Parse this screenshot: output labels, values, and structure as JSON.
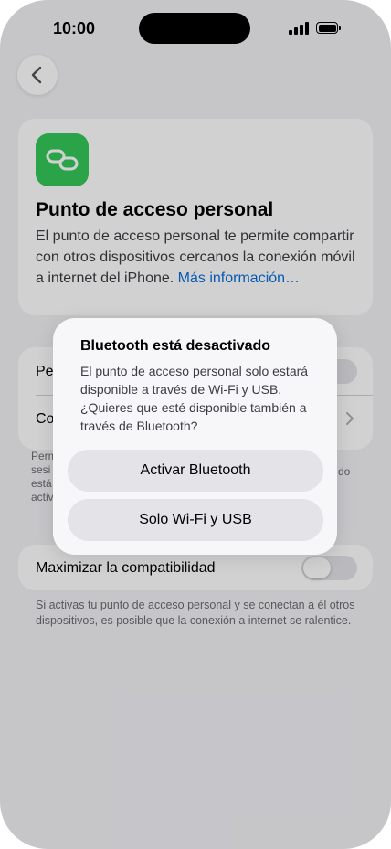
{
  "status": {
    "time": "10:00"
  },
  "hero": {
    "title": "Punto de acceso personal",
    "description": "El punto de acceso personal te permite compartir con otros dispositivos cercanos la conexión móvil a internet del iPhone. ",
    "link": "Más información…"
  },
  "settings": {
    "row1_partial": "Pe",
    "row2_partial": "Co",
    "footer_partial_lines": [
      "Perm",
      "sesi",
      "está",
      "activ"
    ],
    "footer_partial_right": "do"
  },
  "compat": {
    "label": "Maximizar la compatibilidad",
    "footer": "Si activas tu punto de acceso personal y se conectan a él otros dispositivos, es posible que la conexión a internet se ralentice."
  },
  "alert": {
    "title": "Bluetooth está desactivado",
    "message": "El punto de acceso personal solo estará disponible a través de Wi-Fi y USB. ¿Quieres que esté disponible también a través de Bluetooth?",
    "button1": "Activar Bluetooth",
    "button2": "Solo Wi-Fi y USB"
  },
  "colors": {
    "accent_green": "#34c759",
    "link_blue": "#0a6fdc"
  },
  "icons": {
    "back": "chevron-left-icon",
    "app": "link-chain-icon"
  }
}
